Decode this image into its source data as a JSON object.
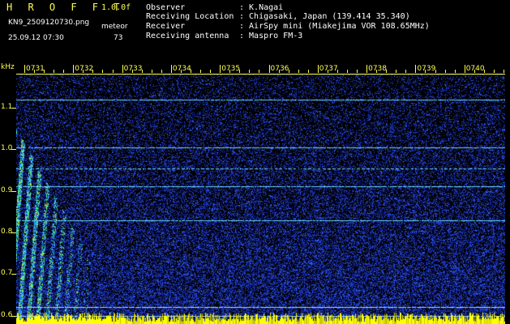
{
  "header": {
    "brand": "H R O F F T",
    "version": "1.0.0f",
    "filename": "KN9_2509120730.png",
    "mode_label": "meteor",
    "count": "73",
    "datetime": "25.09.12 07:30"
  },
  "station": {
    "observer_label": "Observer",
    "observer_value": ": K.Nagai",
    "location_label": "Receiving Location",
    "location_value": ": Chigasaki, Japan (139.414 35.340)",
    "receiver_label": "Receiver",
    "receiver_value": ": AirSpy mini (Miakejima VOR 108.65MHz)",
    "antenna_label": "Receiving antenna",
    "antenna_value": ": Maspro FM-3"
  },
  "colors": {
    "background": "#000000",
    "axis": "#ffff55",
    "noise_low": "#0a0aa0",
    "noise_high": "#2a5cff",
    "line": "#6fd7ff",
    "burst": "#33ff99",
    "overload": "#ffff00"
  },
  "chart_data": {
    "type": "heatmap",
    "yunit": "kHz",
    "y_ticks": [
      "1.1",
      "1.0",
      "0.9",
      "0.8",
      "0.7",
      "0.6"
    ],
    "x_ticks": [
      "0731",
      "0732",
      "0733",
      "0734",
      "0735",
      "0736",
      "0737",
      "0738",
      "0739",
      "0740"
    ],
    "ylim": [
      0.58,
      1.18
    ],
    "xlim_minutes": [
      0,
      10
    ],
    "carrier_lines_khz": [
      1.12,
      1.005,
      0.955,
      0.912,
      0.83,
      0.62,
      0.6
    ],
    "meteor_burst": {
      "start_min": 0,
      "end_min": 1.6,
      "freq_high_khz": 1.05,
      "freq_low_khz": 0.58
    }
  }
}
